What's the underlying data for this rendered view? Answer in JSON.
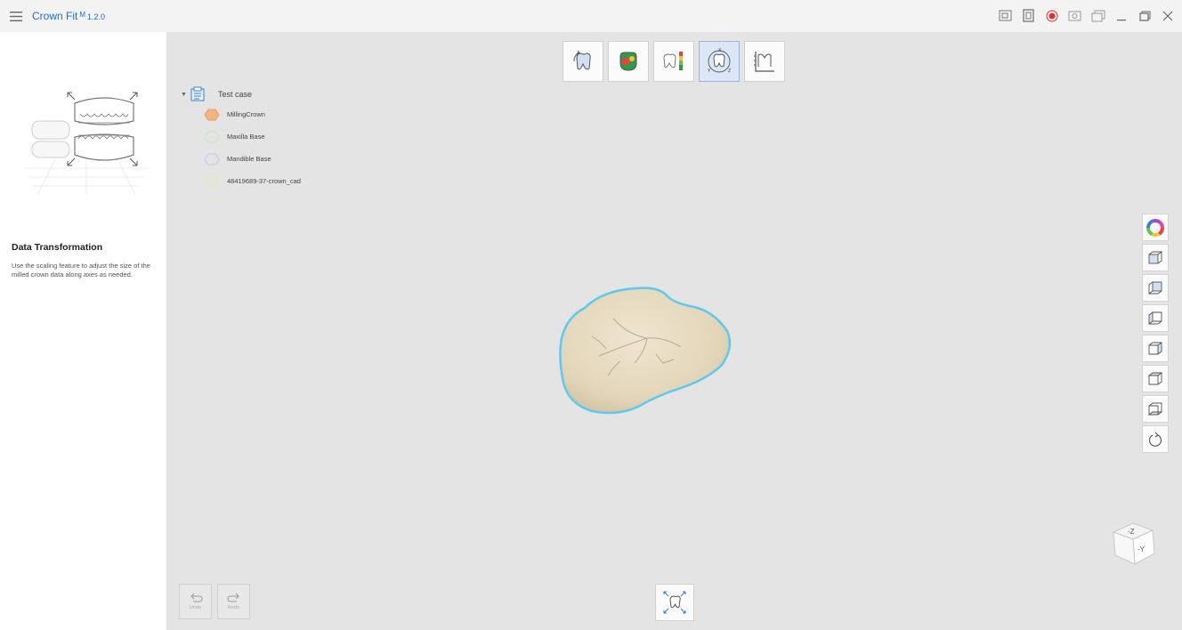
{
  "app": {
    "title": "Crown Fit",
    "edition": "M",
    "version": "1.2.0"
  },
  "window_controls": [
    "screenshot-icon",
    "screen-record-icon",
    "record-dot-icon",
    "camera-icon",
    "window-icon",
    "minimize-icon",
    "maximize-icon",
    "close-icon"
  ],
  "left_panel": {
    "title": "Data Transformation",
    "description": "Use the scaling feature to adjust the size of the milled crown data along axes as needed."
  },
  "toolbar": {
    "tools": [
      {
        "icon": "align-tooth-icon",
        "active": false
      },
      {
        "icon": "color-map-icon",
        "active": false
      },
      {
        "icon": "deviation-scale-icon",
        "active": false
      },
      {
        "icon": "transform-axis-icon",
        "active": true
      },
      {
        "icon": "measure-icon",
        "active": false
      }
    ]
  },
  "tree": {
    "root": "Test case",
    "items": [
      {
        "label": "MillingCrown",
        "color": "#f3b582",
        "fill": true
      },
      {
        "label": "Maxilla Base",
        "color": "#bfe6c2",
        "fill": false
      },
      {
        "label": "Mandible Base",
        "color": "#b9c8ee",
        "fill": false
      },
      {
        "label": "48419689-37-crown_cad",
        "color": "#ece8a6",
        "fill": false
      }
    ]
  },
  "right_tools": [
    "color-wheel-icon",
    "view-front-icon",
    "view-back-icon",
    "view-left-icon",
    "view-right-icon",
    "view-top-icon",
    "view-bottom-icon",
    "reset-view-icon"
  ],
  "undo": {
    "label": "Undo"
  },
  "redo": {
    "label": "Redo"
  },
  "view_cube": {
    "top_face": "-Z",
    "front_face": "-Y"
  },
  "colors": {
    "accent": "#1f6fd0",
    "record_red": "#e03030",
    "crown_outline": "#5ec8ee",
    "crown_body": "#e6dbc2"
  }
}
